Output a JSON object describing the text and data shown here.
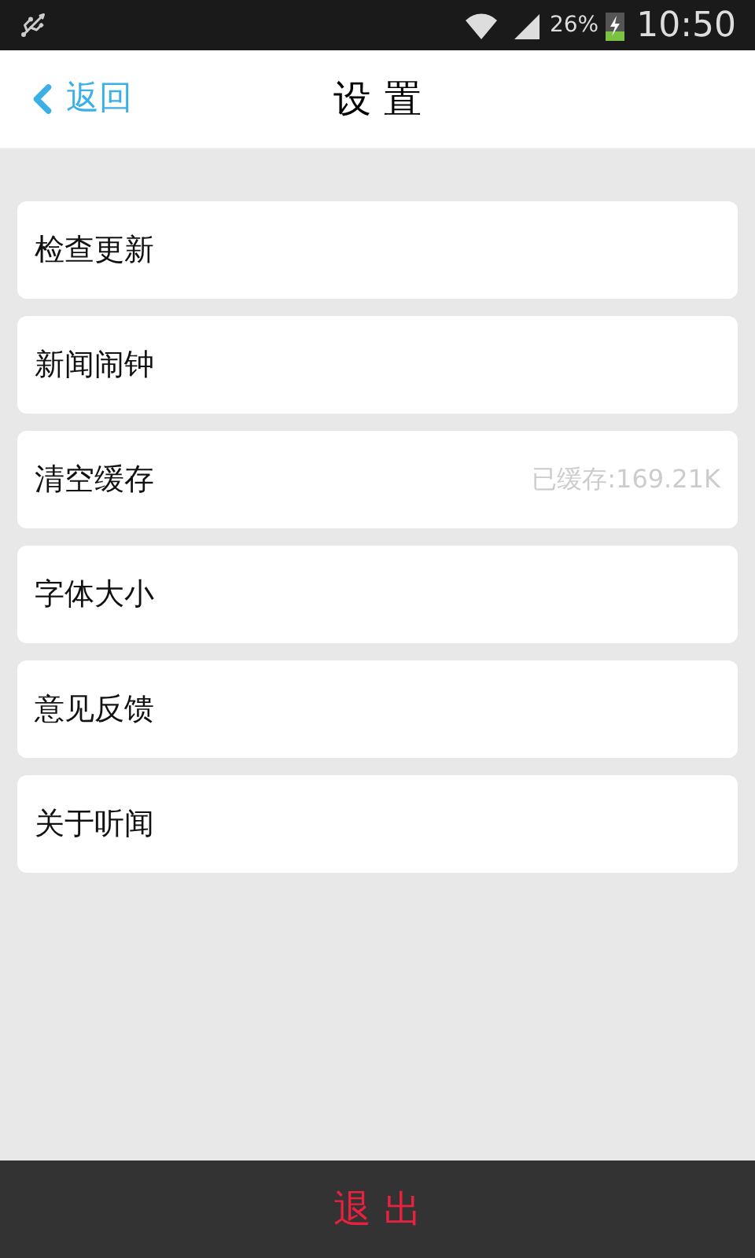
{
  "status_bar": {
    "battery": "26%",
    "time": "10:50"
  },
  "header": {
    "back": "返回",
    "title": "设 置"
  },
  "items": [
    {
      "label": "检查更新"
    },
    {
      "label": "新闻闹钟"
    },
    {
      "label": "清空缓存",
      "detail": "已缓存:169.21K"
    },
    {
      "label": "字体大小"
    },
    {
      "label": "意见反馈"
    },
    {
      "label": "关于听闻"
    }
  ],
  "logout": "退 出"
}
